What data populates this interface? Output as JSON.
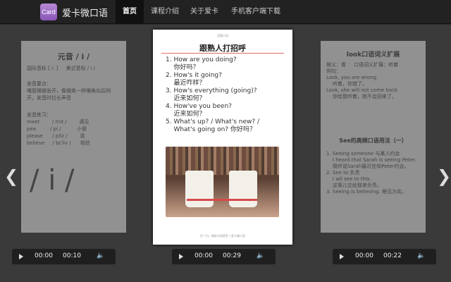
{
  "app": {
    "logo_icon_text": "Card",
    "name": "爱卡微口语"
  },
  "nav": [
    {
      "label": "首页",
      "active": true
    },
    {
      "label": "课程介绍",
      "active": false
    },
    {
      "label": "关于爱卡",
      "active": false
    },
    {
      "label": "手机客户端下载",
      "active": false
    }
  ],
  "left_card": {
    "title": "元音 / i /",
    "line1": "国际音标 [ i: ]     美式音标 / i /",
    "section1_title": "发音要点：",
    "section1_text": "嘴唇微微张开，像微笑一样嘴角向后咧\n开，发音时拉长声音",
    "section2_title": "发音练习：",
    "practice": "meet        / mit /        遇见\npea         / pi /          小便\nplease      / pliz /        请\nbelieve     / bɪˈliv /      相信",
    "big_symbol": "/ i /"
  },
  "center_card": {
    "tiny_header": "话题口语",
    "title": "跟熟人打招呼",
    "items": "1. How are you doing?\n    你好吗？\n2. How's it going?\n    最近咋样？\n3. How's everything (going)?\n    近来如何？\n4. How've you been?\n    近来如何？\n5. What's up? / What's new? /\n    What's going on? 你好吗？",
    "footer": "扫一扫，精彩内容更多 | 爱卡微口语"
  },
  "right_card": {
    "title": "look口语词义扩展",
    "body": "根义：看     口语词义扩展：听着\n例句：\nLook, you are wrong.\n    听着，你错了。\nLook, she will not come back\n    你给我听着，她不会回来了。",
    "section_title": "See的高频口语用法（一）",
    "items": "1. Seeing someone 与某人约会\n    I heard that Sarah is seeing Peter.\n    我听说Sarah最近在和Peter约会。\n2. See to 负责\n    I wil see to this.\n    这事儿交给我来负责。\n3. Seeing is believing. 眼见为实。"
  },
  "players": [
    {
      "current": "00:00",
      "duration": "00:10"
    },
    {
      "current": "00:00",
      "duration": "00:29"
    },
    {
      "current": "00:00",
      "duration": "00:22"
    }
  ],
  "icons": {
    "prev": "chevron-left-icon",
    "next": "chevron-right-icon",
    "play": "play-icon",
    "volume": "volume-icon"
  }
}
